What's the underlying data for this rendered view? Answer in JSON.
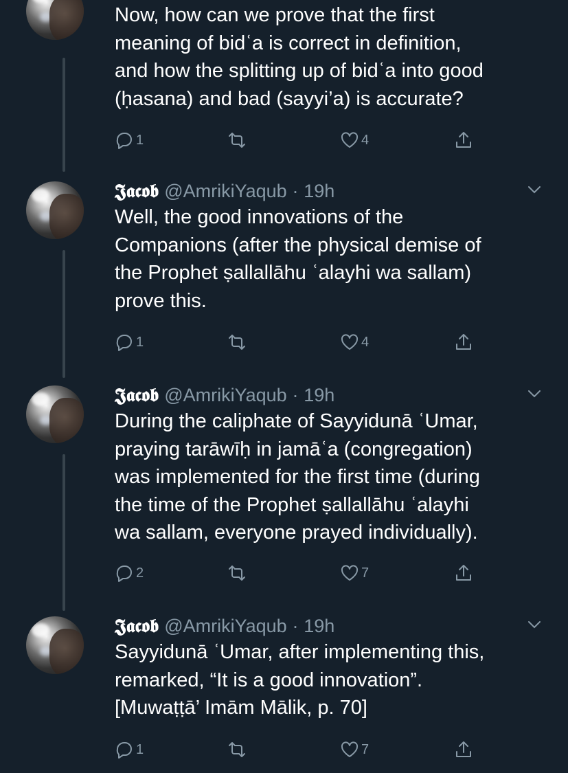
{
  "tweets": [
    {
      "name": "",
      "handle": "",
      "time": "",
      "lines": [
        "Now, how can we prove that the first",
        "meaning of bidʿa is correct in definition,",
        "and how the splitting up of bidʿa into good",
        "(ḥasana) and bad (sayyi’a) is accurate?"
      ],
      "replies": "1",
      "retweets": "",
      "likes": "4"
    },
    {
      "name": "𝕵𝖆𝖈𝖔𝖇",
      "handle": "@AmrikiYaqub",
      "time": "19h",
      "lines": [
        "Well, the good innovations of the",
        "Companions (after the physical demise of",
        "the Prophet ṣallallāhu ʿalayhi wa sallam)",
        "prove this."
      ],
      "replies": "1",
      "retweets": "",
      "likes": "4"
    },
    {
      "name": "𝕵𝖆𝖈𝖔𝖇",
      "handle": "@AmrikiYaqub",
      "time": "19h",
      "lines": [
        "During the caliphate of Sayyidunā ʿUmar,",
        "praying tarāwīḥ in jamāʿa (congregation)",
        "was implemented for the first time (during",
        "the time of the Prophet ṣallallāhu ʿalayhi",
        "wa sallam, everyone prayed individually)."
      ],
      "replies": "2",
      "retweets": "",
      "likes": "7"
    },
    {
      "name": "𝕵𝖆𝖈𝖔𝖇",
      "handle": "@AmrikiYaqub",
      "time": "19h",
      "lines": [
        "Sayyidunā ʿUmar, after implementing this,",
        "remarked, “It is a good innovation”.",
        "[Muwaṭṭā’ Imām Mālik, p. 70]"
      ],
      "replies": "1",
      "retweets": "",
      "likes": "7"
    }
  ],
  "separator": "·",
  "icons": {
    "reply": "reply-icon",
    "retweet": "retweet-icon",
    "like": "heart-icon",
    "share": "share-icon",
    "caret": "chevron-down-icon"
  },
  "colors": {
    "background": "#15202b",
    "text": "#ffffff",
    "secondary": "#8899a6",
    "thread_line": "#38444d"
  }
}
